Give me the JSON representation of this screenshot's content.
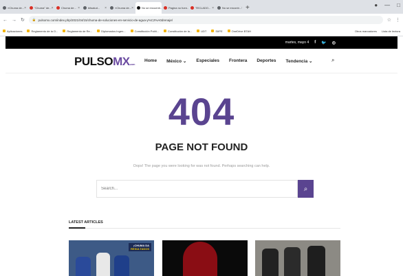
{
  "browser": {
    "tabs": [
      {
        "label": "«Chuma de...",
        "color": "#5f6368",
        "active": false
      },
      {
        "label": "\"Chuma\" de...",
        "color": "#d93025",
        "active": false
      },
      {
        "label": "Chuma de...",
        "color": "#d93025",
        "active": false
      },
      {
        "label": "bitsalud...",
        "color": "#5f6368",
        "active": false
      },
      {
        "label": "«Chuma de...",
        "color": "#5f6368",
        "active": false
      },
      {
        "label": "No se encuentr...",
        "color": "#111111",
        "active": true
      },
      {
        "label": "Pagina no fuen...",
        "color": "#d93025",
        "active": false
      },
      {
        "label": "TECLADO...",
        "color": "#d93025",
        "active": false
      },
      {
        "label": "No se encontr...",
        "color": "#5f6368",
        "active": false
      }
    ],
    "new_tab": "+",
    "url": "pulsomx.com/index.php/2021/04/15/chuma-de-soluciones-en-servicio-de-agua-y%C2%A0drenaje/",
    "bookmarks": [
      "Aplicaciones",
      "Reglamento de la O...",
      "Reglamento de Re...",
      "Diplomados Ingen...",
      "Constitución Políti...",
      "Constitución de la...",
      "UDT",
      "SIIPE",
      "OneDrive BTAH"
    ],
    "bookmarks_right": [
      "Otros marcadores",
      "Lista de lectura"
    ]
  },
  "site": {
    "date": "martes, mayo 4",
    "social": [
      "f",
      "t",
      "ig"
    ],
    "logo_main": "PULSO",
    "logo_accent": "MX",
    "logo_suffix": ".com",
    "menu": [
      "Home",
      "México ⌄",
      "Especiales",
      "Frontera",
      "Deportes",
      "Tendencia ⌄"
    ]
  },
  "error": {
    "code": "404",
    "title": "PAGE NOT FOUND",
    "message": "Oops! The page you were looking for was not found. Perhaps searching can help.",
    "search_placeholder": "Search..."
  },
  "latest": {
    "heading": "LATEST ARTICLES",
    "badge_line1": "¡CHUMA DA",
    "badge_line2": "RESULTADOS"
  },
  "colors": {
    "accent": "#5a4490",
    "topbar": "#000000"
  }
}
